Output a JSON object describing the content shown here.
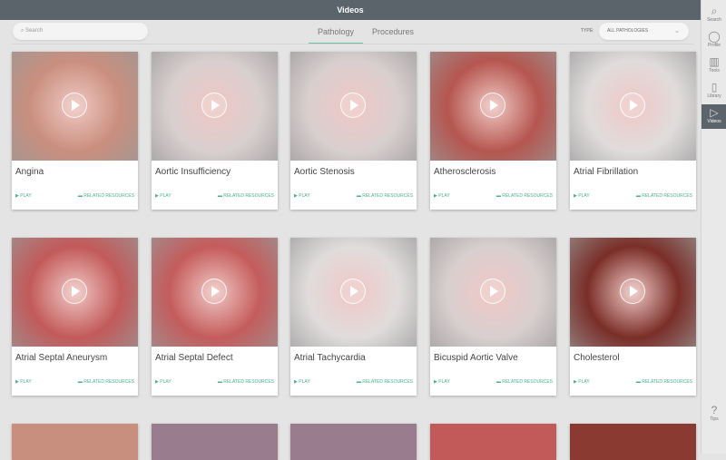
{
  "header": {
    "title": "Videos"
  },
  "search": {
    "placeholder": "Search"
  },
  "tabs": [
    {
      "label": "Pathology",
      "active": true
    },
    {
      "label": "Procedures",
      "active": false
    }
  ],
  "filter": {
    "label": "TYPE:",
    "value": "ALL PATHOLOGIES"
  },
  "sidebar": {
    "items": [
      {
        "label": "Search",
        "icon": "search-icon"
      },
      {
        "label": "Profile",
        "icon": "profile-icon"
      },
      {
        "label": "Tools",
        "icon": "tools-icon"
      },
      {
        "label": "Library",
        "icon": "library-icon"
      },
      {
        "label": "Videos",
        "icon": "videos-icon",
        "active": true
      }
    ],
    "tips": "Tips"
  },
  "card_actions": {
    "play": "PLAY",
    "related": "RELATED RESOURCES"
  },
  "cards": [
    {
      "title": "Angina",
      "bg": "#c98f7e"
    },
    {
      "title": "Aortic Insufficiency",
      "bg": "#d9cfcf"
    },
    {
      "title": "Aortic Stenosis",
      "bg": "#d9cfcf"
    },
    {
      "title": "Atherosclerosis",
      "bg": "#b5564f"
    },
    {
      "title": "Atrial Fibrillation",
      "bg": "#e0dcdc"
    },
    {
      "title": "Atrial Septal Aneurysm",
      "bg": "#c25a5a"
    },
    {
      "title": "Atrial Septal Defect",
      "bg": "#c45c5c"
    },
    {
      "title": "Atrial Tachycardia",
      "bg": "#e0dcdc"
    },
    {
      "title": "Bicuspid Aortic Valve",
      "bg": "#d9cfcf"
    },
    {
      "title": "Cholesterol",
      "bg": "#7a2e28"
    }
  ]
}
